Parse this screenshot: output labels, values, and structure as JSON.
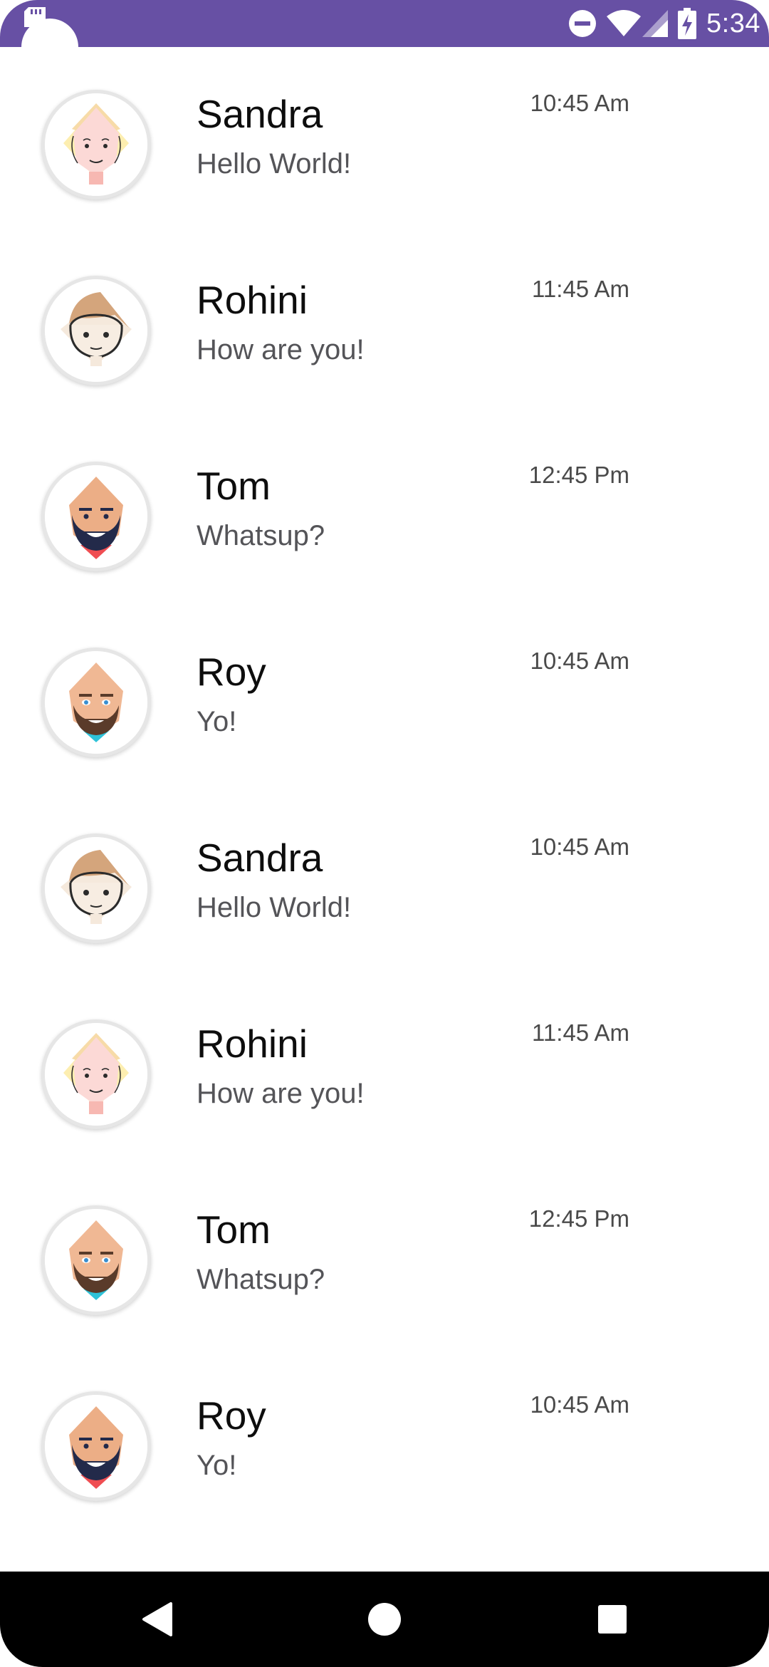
{
  "status_bar": {
    "time": "5:34",
    "background_color": "#6750a4",
    "icons": [
      "sd-card-icon",
      "do-not-disturb-icon",
      "wifi-icon",
      "signal-icon",
      "battery-charging-icon"
    ]
  },
  "chats": [
    {
      "name": "Sandra",
      "message": "Hello World!",
      "time": "10:45 Am",
      "avatar": "avatar-woman-blonde"
    },
    {
      "name": "Rohini",
      "message": "How are you!",
      "time": "11:45 Am",
      "avatar": "avatar-girl-brown-hair"
    },
    {
      "name": "Tom",
      "message": "Whatsup?",
      "time": "12:45 Pm",
      "avatar": "avatar-man-dark-beard"
    },
    {
      "name": "Roy",
      "message": "Yo!",
      "time": "10:45 Am",
      "avatar": "avatar-man-brown-beard"
    },
    {
      "name": "Sandra",
      "message": "Hello World!",
      "time": "10:45 Am",
      "avatar": "avatar-girl-brown-hair"
    },
    {
      "name": "Rohini",
      "message": "How are you!",
      "time": "11:45 Am",
      "avatar": "avatar-woman-blonde"
    },
    {
      "name": "Tom",
      "message": "Whatsup?",
      "time": "12:45 Pm",
      "avatar": "avatar-man-brown-beard"
    },
    {
      "name": "Roy",
      "message": "Yo!",
      "time": "10:45 Am",
      "avatar": "avatar-man-dark-beard"
    }
  ],
  "nav_bar": {
    "buttons": [
      "back-icon",
      "home-icon",
      "recents-icon"
    ]
  }
}
